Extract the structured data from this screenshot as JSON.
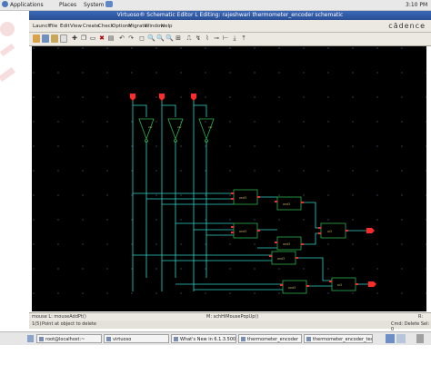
{
  "panel": {
    "applications": "Applications",
    "places": "Places",
    "system": "System",
    "clock": "3:10 PM"
  },
  "window": {
    "title": "Virtuoso® Schematic Editor L Editing: rajeshwari thermometer_encoder schematic"
  },
  "menu": {
    "items": [
      "Launch",
      "File",
      "Edit",
      "View",
      "Create",
      "Check",
      "Options",
      "Migrate",
      "Window",
      "Help"
    ],
    "brand": "cādence"
  },
  "status": {
    "left": "mouse L: mouseAddPt()",
    "middle": "M: schHiMousePopUp()",
    "right": "R:",
    "prompt_number": "1(5)",
    "prompt": "Point at object to delete",
    "right_info": "Cmd: Delete Sel: 0"
  },
  "taskbar": {
    "items": [
      "root@localhost:~",
      "virtuoso",
      "What's New in 6.1.3.500",
      "thermometer_encoder",
      "thermometer_encoder_test"
    ]
  },
  "schematic": {
    "inverter_labels": [
      "inv",
      "inv",
      "inv"
    ],
    "gate_labels": [
      "and3",
      "and3",
      "and3",
      "and3",
      "and3",
      "and3",
      "or2",
      "or2"
    ]
  },
  "colors": {
    "canvas": "#000000",
    "wire": "#2fd3c6",
    "pin": "#ff2a2a",
    "gate": "#2fb04a",
    "titlebar": "#2a4f95"
  }
}
